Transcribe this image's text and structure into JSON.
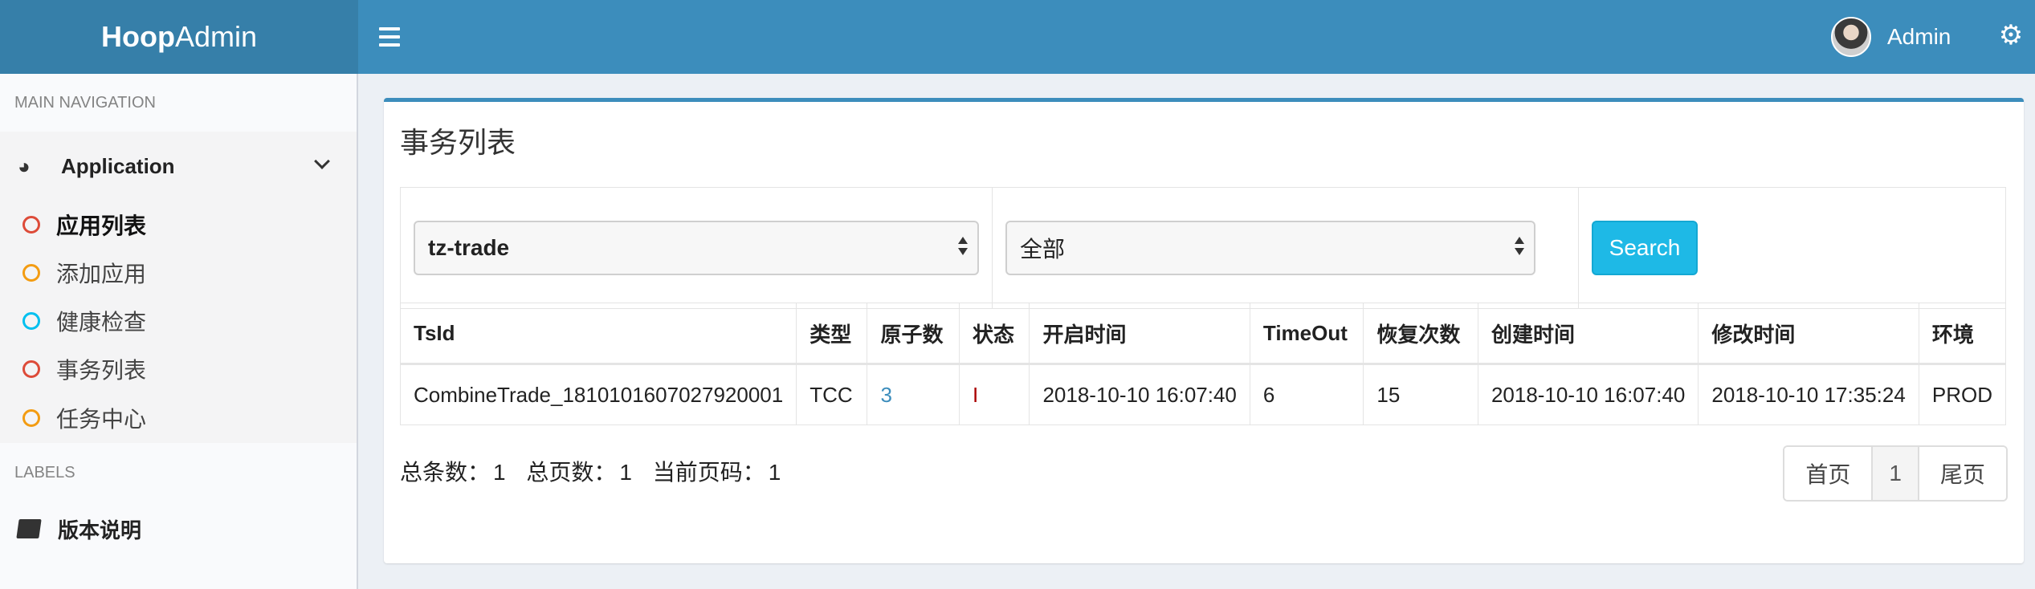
{
  "header": {
    "logo_bold": "Hoop",
    "logo_rest": "Admin",
    "user_name": "Admin"
  },
  "sidebar": {
    "main_nav_label": "MAIN NAVIGATION",
    "group_label": "Application",
    "items": [
      {
        "label": "应用列表",
        "color": "#dd4b39"
      },
      {
        "label": "添加应用",
        "color": "#f39c12"
      },
      {
        "label": "健康检查",
        "color": "#00c0ef"
      },
      {
        "label": "事务列表",
        "color": "#dd4b39"
      },
      {
        "label": "任务中心",
        "color": "#f39c12"
      }
    ],
    "labels_header": "LABELS",
    "version_label": "版本说明"
  },
  "main": {
    "title": "事务列表",
    "filters": {
      "app_select": "tz-trade",
      "status_select": "全部",
      "search_label": "Search"
    },
    "table": {
      "headers": [
        "TsId",
        "类型",
        "原子数",
        "状态",
        "开启时间",
        "TimeOut",
        "恢复次数",
        "创建时间",
        "修改时间",
        "环境"
      ],
      "rows": [
        [
          "CombineTrade_1810101607027920001",
          "TCC",
          "3",
          "I",
          "2018-10-10 16:07:40",
          "6",
          "15",
          "2018-10-10 16:07:40",
          "2018-10-10 17:35:24",
          "PROD"
        ]
      ]
    },
    "summary": {
      "total_label": "总条数：",
      "total_value": "1",
      "pages_label": "总页数：",
      "pages_value": "1",
      "current_label": "当前页码：",
      "current_value": "1"
    },
    "pager": {
      "first": "首页",
      "current": "1",
      "last": "尾页"
    }
  },
  "colors": {
    "header": "#3c8dbc",
    "logo_bg": "#367fa9",
    "search_button": "#1eb9e6",
    "link": "#3c8dbc"
  }
}
